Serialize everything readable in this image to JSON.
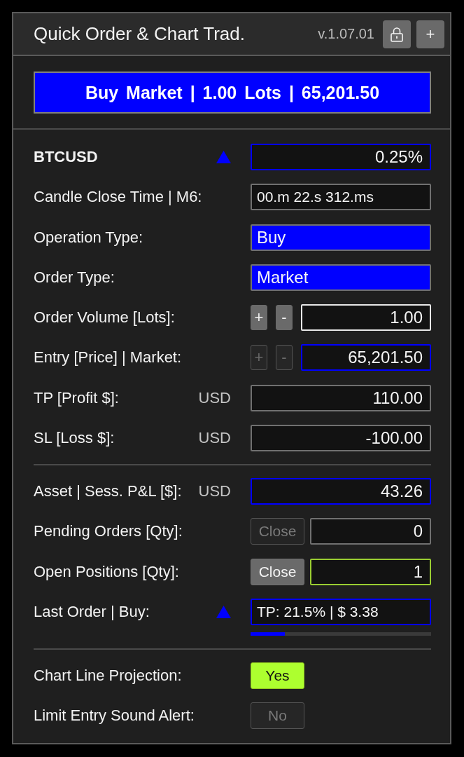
{
  "window": {
    "title": "Quick Order & Chart Trad.",
    "version": "v.1.07.01",
    "buttons": [
      {
        "kind": "lock"
      },
      {
        "kind": "text",
        "label": "+"
      }
    ]
  },
  "order_button": {
    "label": "Buy Market | 1.00 Lots | 65,201.50"
  },
  "sections": [
    {
      "rows": [
        {
          "kind": "symbol",
          "label": "BTCUSD",
          "rising": true,
          "field": {
            "kind": "readout",
            "value": "0.25%",
            "color": "#0000ff"
          }
        },
        {
          "kind": "field",
          "label": "Candle Close Time | M6:",
          "field": {
            "kind": "status",
            "value": "00.m 22.s 312.ms",
            "color": "#707070"
          }
        },
        {
          "kind": "field",
          "label": "Operation Type:",
          "field": {
            "kind": "select",
            "value": "Buy",
            "color": "#707070"
          }
        },
        {
          "kind": "field",
          "label": "Order Type:",
          "field": {
            "kind": "select",
            "value": "Market",
            "color": "#707070"
          }
        },
        {
          "kind": "stepper",
          "label": "Order Volume [Lots]:",
          "steppers": [
            {
              "label": "+",
              "disabled": false
            },
            {
              "label": "-",
              "disabled": false
            }
          ],
          "field": {
            "kind": "input",
            "value": "1.00",
            "color": "#e8e8e8"
          }
        },
        {
          "kind": "stepper",
          "label": "Entry [Price] | Market:",
          "steppers": [
            {
              "label": "+",
              "disabled": true
            },
            {
              "label": "-",
              "disabled": true
            }
          ],
          "field": {
            "kind": "input",
            "value": "65,201.50",
            "color": "#0000ff"
          }
        },
        {
          "kind": "unit",
          "label": "TP [Profit $]:",
          "unit": "USD",
          "field": {
            "kind": "input",
            "value": "110.00",
            "color": "#707070"
          }
        },
        {
          "kind": "unit",
          "label": "SL [Loss $]:",
          "unit": "USD",
          "field": {
            "kind": "input",
            "value": "-100.00",
            "color": "#707070"
          }
        }
      ]
    },
    {
      "rows": [
        {
          "kind": "unit",
          "label": "Asset | Sess. P&L [$]:",
          "unit": "USD",
          "field": {
            "kind": "readout",
            "value": "43.26",
            "color": "#0000ff"
          }
        },
        {
          "kind": "action",
          "label": "Pending Orders [Qty]:",
          "button": {
            "label": "Close",
            "disabled": true
          },
          "field": {
            "kind": "readout",
            "value": "0",
            "color": "#707070"
          }
        },
        {
          "kind": "action",
          "label": "Open Positions [Qty]:",
          "button": {
            "label": "Close",
            "disabled": false
          },
          "field": {
            "kind": "readout",
            "value": "1",
            "color": "#9acd32"
          }
        },
        {
          "kind": "progress",
          "label": "Last Order | Buy:",
          "rising": true,
          "field": {
            "kind": "status",
            "value": "TP: 21.5% | $ 3.38",
            "color": "#0000ff"
          },
          "level": 0.19
        }
      ]
    },
    {
      "rows": [
        {
          "kind": "toggle",
          "label": "Chart Line Projection:",
          "toggle": {
            "label": "Yes",
            "on": true
          }
        },
        {
          "kind": "toggle",
          "label": "Limit Entry Sound Alert:",
          "toggle": {
            "label": "No",
            "on": false
          }
        }
      ]
    }
  ]
}
